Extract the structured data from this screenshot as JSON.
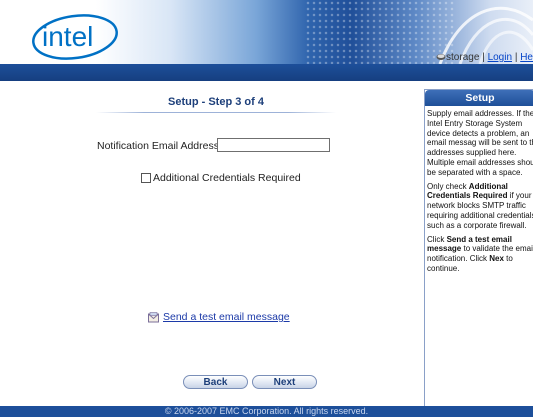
{
  "header": {
    "logo_text": "intel",
    "storage_label": "storage",
    "login_link": "Login",
    "help_link": "He",
    "separator": "|"
  },
  "wizard": {
    "step_title": "Setup - Step 3 of 4",
    "email_label": "Notification Email Address:",
    "email_value": "",
    "credentials_label": "Additional Credentials Required",
    "credentials_checked": false,
    "test_email_link": "Send a test email message",
    "back_button": "Back",
    "next_button": "Next"
  },
  "help": {
    "title": "Setup",
    "p1": "Supply email addresses. If the Intel Entry Storage System device detects a problem, an email messag will be sent to the addresses supplied here. Multiple email addresses should be separated with a space.",
    "p2_pre": "Only check ",
    "p2_bold": "Additional Credentials Required",
    "p2_post": " if your network blocks SMTP traffic requiring additional credentials, such as a corporate firewall.",
    "p3_pre": "Click ",
    "p3_bold": "Send a test email message",
    "p3_mid": " to validate the email notification. Click ",
    "p3_bold2": "Nex",
    "p3_post": " to continue."
  },
  "footer": {
    "copyright": "© 2006-2007 EMC Corporation. All rights reserved."
  },
  "colors": {
    "brand_blue": "#1d4f9a",
    "link_blue": "#1c3aa8",
    "title_blue": "#1d3f7a"
  }
}
